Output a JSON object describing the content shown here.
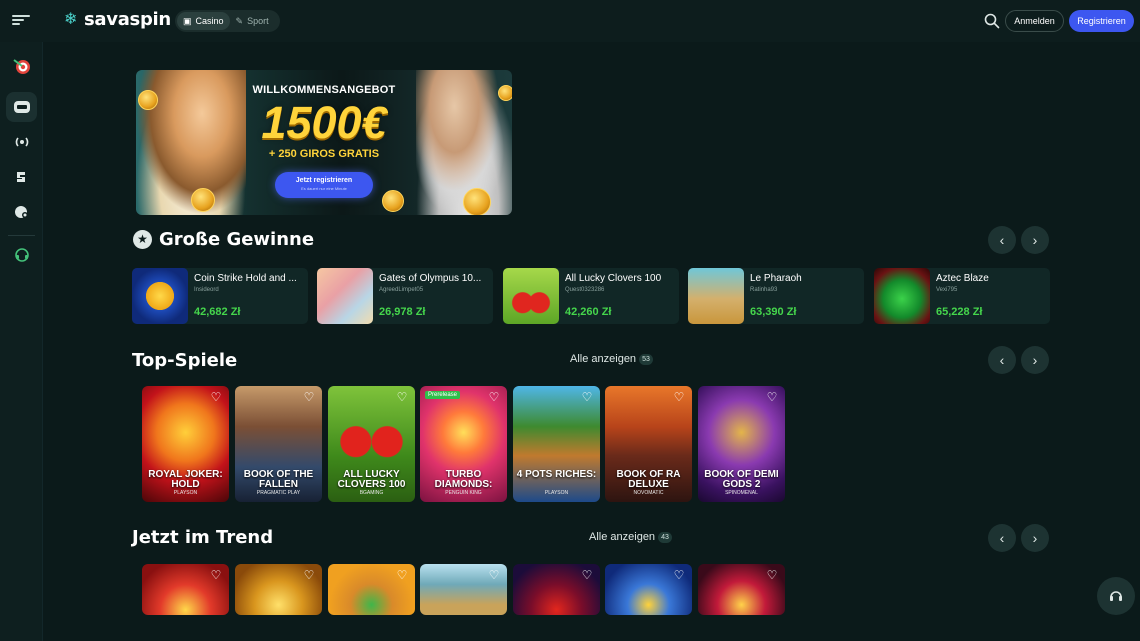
{
  "header": {
    "brand": "savaspin",
    "tabs": [
      {
        "label": "Casino",
        "icon": "slot-machine-icon",
        "active": true
      },
      {
        "label": "Sport",
        "icon": "sport-icon",
        "active": false
      }
    ],
    "login_label": "Anmelden",
    "register_label": "Registrieren",
    "accent_color": "#3d57f0"
  },
  "sidebar": {
    "items": [
      {
        "icon": "target-icon"
      },
      {
        "icon": "slot-machine-icon",
        "active": true
      },
      {
        "icon": "live-broadcast-icon"
      },
      {
        "icon": "sport-icon"
      },
      {
        "icon": "controller-icon"
      },
      {
        "icon": "support-headset-icon"
      }
    ]
  },
  "banner": {
    "title": "WILLKOMMENSANGEBOT",
    "amount": "1500€",
    "subtitle": "+ 250 GIROS GRATIS",
    "cta_label": "Jetzt registrieren",
    "cta_sub": "Es dauert nur eine Minute"
  },
  "big_wins": {
    "title": "Große Gewinne",
    "items": [
      {
        "game": "Coin Strike Hold and ...",
        "user": "Insideord",
        "amount": "42,682 Zł"
      },
      {
        "game": "Gates of Olympus 10...",
        "user": "AgreedLimpet05",
        "amount": "26,978 Zł"
      },
      {
        "game": "All Lucky Clovers 100",
        "user": "Quest0323286",
        "amount": "42,260 Zł"
      },
      {
        "game": "Le Pharaoh",
        "user": "Ratinha93",
        "amount": "63,390 Zł"
      },
      {
        "game": "Aztec Blaze",
        "user": "Vexi795",
        "amount": "65,228 Zł"
      }
    ]
  },
  "top_games": {
    "title": "Top-Spiele",
    "see_all": "Alle anzeigen",
    "count": "53",
    "items": [
      {
        "name": "ROYAL JOKER: HOLD",
        "provider": "PLAYSON"
      },
      {
        "name": "BOOK OF THE FALLEN",
        "provider": "PRAGMATIC PLAY"
      },
      {
        "name": "ALL LUCKY CLOVERS 100",
        "provider": "BGAMING"
      },
      {
        "name": "TURBO DIAMONDS:",
        "provider": "PENGUIN KING",
        "tag": "Prerelease"
      },
      {
        "name": "4 POTS RICHES:",
        "provider": "PLAYSON"
      },
      {
        "name": "BOOK OF RA DELUXE",
        "provider": "NOVOMATIC"
      },
      {
        "name": "BOOK OF DEMI GODS 2",
        "provider": "SPINOMENAL"
      }
    ]
  },
  "trending": {
    "title": "Jetzt im Trend",
    "see_all": "Alle anzeigen",
    "count": "43"
  }
}
